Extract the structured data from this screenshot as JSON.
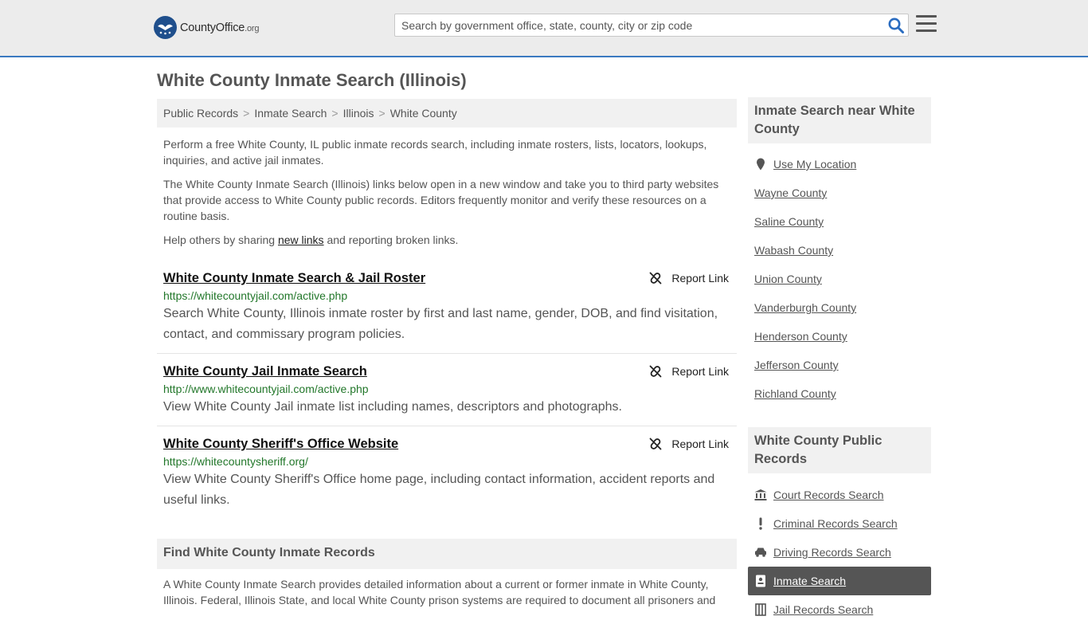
{
  "header": {
    "logo_text": "CountyOffice",
    "logo_tld": ".org",
    "search_placeholder": "Search by government office, state, county, city or zip code"
  },
  "page_title": "White County Inmate Search (Illinois)",
  "breadcrumb": [
    "Public Records",
    "Inmate Search",
    "Illinois",
    "White County"
  ],
  "intro": {
    "p1": "Perform a free White County, IL public inmate records search, including inmate rosters, lists, locators, lookups, inquiries, and active jail inmates.",
    "p2": "The White County Inmate Search (Illinois) links below open in a new window and take you to third party websites that provide access to White County public records. Editors frequently monitor and verify these resources on a routine basis.",
    "p3_before": "Help others by sharing ",
    "p3_link": "new links",
    "p3_after": " and reporting broken links."
  },
  "results": [
    {
      "title": "White County Inmate Search & Jail Roster",
      "url": "https://whitecountyjail.com/active.php",
      "desc": "Search White County, Illinois inmate roster by first and last name, gender, DOB, and find visitation, contact, and commissary program policies.",
      "report": "Report Link"
    },
    {
      "title": "White County Jail Inmate Search",
      "url": "http://www.whitecountyjail.com/active.php",
      "desc": "View White County Jail inmate list including names, descriptors and photographs.",
      "report": "Report Link"
    },
    {
      "title": "White County Sheriff's Office Website",
      "url": "https://whitecountysheriff.org/",
      "desc": "View White County Sheriff's Office home page, including contact information, accident reports and useful links.",
      "report": "Report Link"
    }
  ],
  "find": {
    "heading": "Find White County Inmate Records",
    "text": "A White County Inmate Search provides detailed information about a current or former inmate in White County, Illinois. Federal, Illinois State, and local White County prison systems are required to document all prisoners and"
  },
  "sidebar": {
    "nearby_heading": "Inmate Search near White County",
    "nearby": [
      "Use My Location",
      "Wayne County",
      "Saline County",
      "Wabash County",
      "Union County",
      "Vanderburgh County",
      "Henderson County",
      "Jefferson County",
      "Richland County"
    ],
    "records_heading": "White County Public Records",
    "records": [
      "Court Records Search",
      "Criminal Records Search",
      "Driving Records Search",
      "Inmate Search",
      "Jail Records Search"
    ]
  },
  "colors": {
    "accent": "#3a79c0",
    "url_green": "#22772a",
    "active_bg": "#555555"
  }
}
